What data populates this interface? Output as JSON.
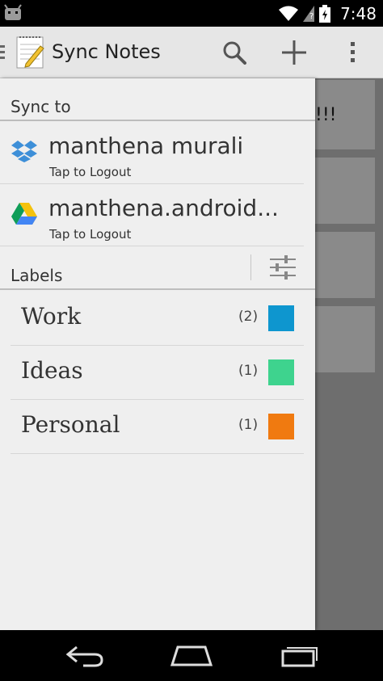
{
  "status_bar": {
    "time": "7:48"
  },
  "action_bar": {
    "title": "Sync Notes",
    "icons": [
      "drawer-indicator-icon",
      "notes-app-icon",
      "search-icon",
      "add-icon",
      "overflow-menu-icon"
    ]
  },
  "background_note": {
    "visible_text": "!!!"
  },
  "drawer": {
    "sync_header": "Sync to",
    "accounts": [
      {
        "service": "dropbox",
        "name": "manthena murali",
        "subtitle": "Tap to Logout"
      },
      {
        "service": "google-drive",
        "name": "manthena.android...",
        "subtitle": "Tap to Logout"
      }
    ],
    "labels_header": "Labels",
    "labels": [
      {
        "name": "Work",
        "count": "(2)",
        "color": "#0e96cf"
      },
      {
        "name": "Ideas",
        "count": "(1)",
        "color": "#3ed38e"
      },
      {
        "name": "Personal",
        "count": "(1)",
        "color": "#f07a10"
      }
    ]
  },
  "colors": {
    "action_bar": "#e6e6e6",
    "drawer": "#efefef",
    "overlay": "#6e6e6e"
  }
}
